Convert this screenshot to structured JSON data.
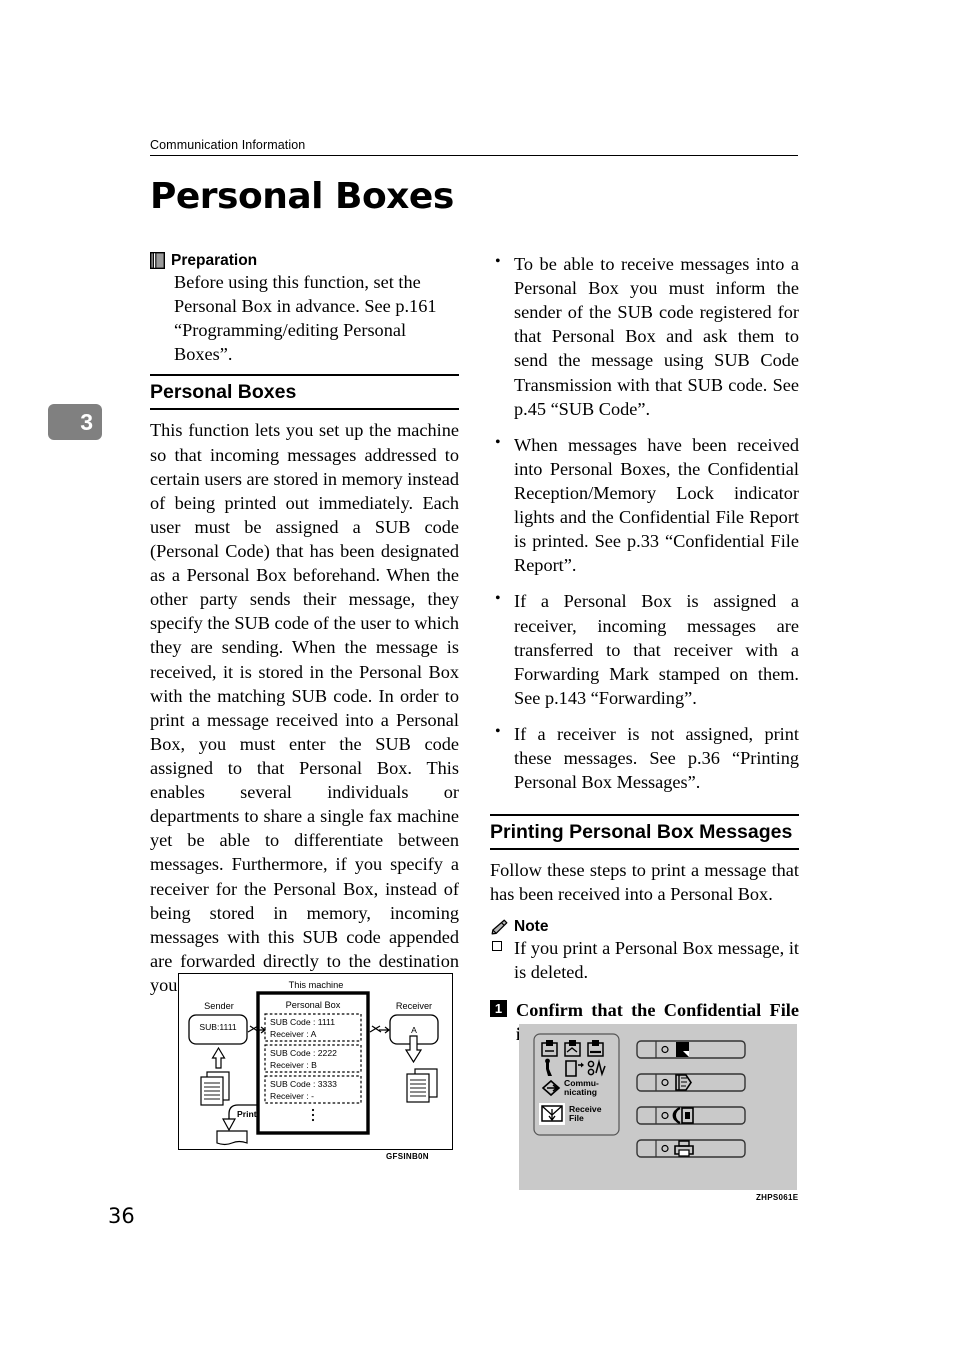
{
  "running_head": "Communication Information",
  "page_title": "Personal Boxes",
  "chapter_tab": "3",
  "folio": "36",
  "left_column": {
    "preparation": {
      "icon": "book-icon",
      "label": "Preparation",
      "text": "Before using this function, set the Personal Box in advance. See p.161 “Programming/editing Personal Boxes”."
    },
    "section_heading": "Personal Boxes",
    "body": "This function lets you set up the machine so that incoming messages addressed to certain users are stored in memory instead of being printed out immediately. Each user must be assigned a SUB code (Personal Code) that has been designated as a Personal Box beforehand. When the other party sends their message, they specify the SUB code of the user to which they are sending. When the message is received, it is stored in the Personal Box with the matching SUB code. In order to print a message received into a Personal Box, you must enter the SUB code assigned to that Personal Box. This enables several individuals or departments to share a single fax machine yet be able to differentiate between messages. Furthermore, if you specify a receiver for the Personal Box, instead of being stored in memory, incoming messages with this SUB code appended are forwarded directly to the destination you specify."
  },
  "right_column": {
    "bullets": [
      "To be able to receive messages into a Personal Box you must inform the sender of the SUB code registered for that Personal Box and ask them to send the message using SUB Code Transmission with that SUB code. See p.45 “SUB Code”.",
      "When messages have been received into Personal Boxes, the Confidential Reception/Memory Lock indicator lights and the Confidential File Report is printed. See p.33 “Confidential File Report”.",
      "If a Personal Box is assigned a receiver, incoming messages are transferred to that receiver with a Forwarding Mark stamped on them. See p.143 “Forwarding”.",
      "If a receiver is not assigned, print these messages. See p.36 “Printing Personal Box Messages”."
    ],
    "section_heading": "Printing Personal Box Messages",
    "intro": "Follow these steps to print a message that has been received into a Personal Box.",
    "note": {
      "icon": "pencil-icon",
      "label": "Note",
      "items": [
        "If you print a Personal Box message, it is deleted."
      ]
    },
    "step_1": {
      "number": "1",
      "text": "Confirm that the Confidential File indicator is lit."
    }
  },
  "figures": {
    "diagram": {
      "caption": "GFSINB0N",
      "title_this_machine": "This machine",
      "sender_label": "Sender",
      "sender_box": "SUB:1111",
      "personal_box_label": "Personal Box",
      "entries": [
        {
          "sub_code": "SUB Code : 1111",
          "receiver": "Receiver : A"
        },
        {
          "sub_code": "SUB Code : 2222",
          "receiver": "Receiver : B"
        },
        {
          "sub_code": "SUB Code : 3333",
          "receiver": "Receiver : -"
        }
      ],
      "ellipsis": "⋮",
      "print_label": "Print",
      "receiver_label": "Receiver",
      "receiver_box": "A"
    },
    "control_panel": {
      "caption": "ZHPS061E",
      "indicator_communicating": "Commu-\nnicating",
      "indicator_communicating_line1": "Commu-",
      "indicator_communicating_line2": "nicating",
      "indicator_receive_file_line1": "Receive",
      "indicator_receive_file_line2": "File",
      "status_icons": [
        "add-toner-icon",
        "add-staple-icon",
        "load-paper-icon",
        "service-call-icon",
        "open-cover-icon",
        "misfeed-icon"
      ],
      "buttons": [
        "copy-key-icon",
        "document-server-key-icon",
        "facsimile-key-icon",
        "printer-key-icon"
      ]
    }
  },
  "colors": {
    "chapter_tab_bg": "#808080",
    "panel_bg": "#c9c9c9",
    "rule": "#000000"
  }
}
